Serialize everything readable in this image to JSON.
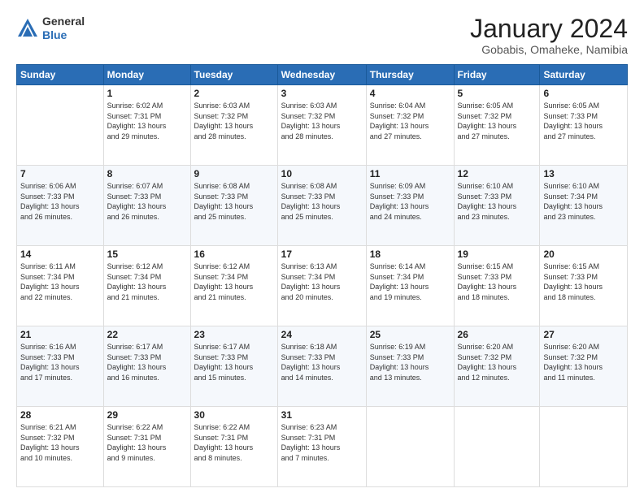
{
  "header": {
    "logo": {
      "line1": "General",
      "line2": "Blue"
    },
    "title": "January 2024",
    "location": "Gobabis, Omaheke, Namibia"
  },
  "days_of_week": [
    "Sunday",
    "Monday",
    "Tuesday",
    "Wednesday",
    "Thursday",
    "Friday",
    "Saturday"
  ],
  "weeks": [
    [
      {
        "day": "",
        "info": ""
      },
      {
        "day": "1",
        "info": "Sunrise: 6:02 AM\nSunset: 7:31 PM\nDaylight: 13 hours\nand 29 minutes."
      },
      {
        "day": "2",
        "info": "Sunrise: 6:03 AM\nSunset: 7:32 PM\nDaylight: 13 hours\nand 28 minutes."
      },
      {
        "day": "3",
        "info": "Sunrise: 6:03 AM\nSunset: 7:32 PM\nDaylight: 13 hours\nand 28 minutes."
      },
      {
        "day": "4",
        "info": "Sunrise: 6:04 AM\nSunset: 7:32 PM\nDaylight: 13 hours\nand 27 minutes."
      },
      {
        "day": "5",
        "info": "Sunrise: 6:05 AM\nSunset: 7:32 PM\nDaylight: 13 hours\nand 27 minutes."
      },
      {
        "day": "6",
        "info": "Sunrise: 6:05 AM\nSunset: 7:33 PM\nDaylight: 13 hours\nand 27 minutes."
      }
    ],
    [
      {
        "day": "7",
        "info": "Sunrise: 6:06 AM\nSunset: 7:33 PM\nDaylight: 13 hours\nand 26 minutes."
      },
      {
        "day": "8",
        "info": "Sunrise: 6:07 AM\nSunset: 7:33 PM\nDaylight: 13 hours\nand 26 minutes."
      },
      {
        "day": "9",
        "info": "Sunrise: 6:08 AM\nSunset: 7:33 PM\nDaylight: 13 hours\nand 25 minutes."
      },
      {
        "day": "10",
        "info": "Sunrise: 6:08 AM\nSunset: 7:33 PM\nDaylight: 13 hours\nand 25 minutes."
      },
      {
        "day": "11",
        "info": "Sunrise: 6:09 AM\nSunset: 7:33 PM\nDaylight: 13 hours\nand 24 minutes."
      },
      {
        "day": "12",
        "info": "Sunrise: 6:10 AM\nSunset: 7:33 PM\nDaylight: 13 hours\nand 23 minutes."
      },
      {
        "day": "13",
        "info": "Sunrise: 6:10 AM\nSunset: 7:34 PM\nDaylight: 13 hours\nand 23 minutes."
      }
    ],
    [
      {
        "day": "14",
        "info": "Sunrise: 6:11 AM\nSunset: 7:34 PM\nDaylight: 13 hours\nand 22 minutes."
      },
      {
        "day": "15",
        "info": "Sunrise: 6:12 AM\nSunset: 7:34 PM\nDaylight: 13 hours\nand 21 minutes."
      },
      {
        "day": "16",
        "info": "Sunrise: 6:12 AM\nSunset: 7:34 PM\nDaylight: 13 hours\nand 21 minutes."
      },
      {
        "day": "17",
        "info": "Sunrise: 6:13 AM\nSunset: 7:34 PM\nDaylight: 13 hours\nand 20 minutes."
      },
      {
        "day": "18",
        "info": "Sunrise: 6:14 AM\nSunset: 7:34 PM\nDaylight: 13 hours\nand 19 minutes."
      },
      {
        "day": "19",
        "info": "Sunrise: 6:15 AM\nSunset: 7:33 PM\nDaylight: 13 hours\nand 18 minutes."
      },
      {
        "day": "20",
        "info": "Sunrise: 6:15 AM\nSunset: 7:33 PM\nDaylight: 13 hours\nand 18 minutes."
      }
    ],
    [
      {
        "day": "21",
        "info": "Sunrise: 6:16 AM\nSunset: 7:33 PM\nDaylight: 13 hours\nand 17 minutes."
      },
      {
        "day": "22",
        "info": "Sunrise: 6:17 AM\nSunset: 7:33 PM\nDaylight: 13 hours\nand 16 minutes."
      },
      {
        "day": "23",
        "info": "Sunrise: 6:17 AM\nSunset: 7:33 PM\nDaylight: 13 hours\nand 15 minutes."
      },
      {
        "day": "24",
        "info": "Sunrise: 6:18 AM\nSunset: 7:33 PM\nDaylight: 13 hours\nand 14 minutes."
      },
      {
        "day": "25",
        "info": "Sunrise: 6:19 AM\nSunset: 7:33 PM\nDaylight: 13 hours\nand 13 minutes."
      },
      {
        "day": "26",
        "info": "Sunrise: 6:20 AM\nSunset: 7:32 PM\nDaylight: 13 hours\nand 12 minutes."
      },
      {
        "day": "27",
        "info": "Sunrise: 6:20 AM\nSunset: 7:32 PM\nDaylight: 13 hours\nand 11 minutes."
      }
    ],
    [
      {
        "day": "28",
        "info": "Sunrise: 6:21 AM\nSunset: 7:32 PM\nDaylight: 13 hours\nand 10 minutes."
      },
      {
        "day": "29",
        "info": "Sunrise: 6:22 AM\nSunset: 7:31 PM\nDaylight: 13 hours\nand 9 minutes."
      },
      {
        "day": "30",
        "info": "Sunrise: 6:22 AM\nSunset: 7:31 PM\nDaylight: 13 hours\nand 8 minutes."
      },
      {
        "day": "31",
        "info": "Sunrise: 6:23 AM\nSunset: 7:31 PM\nDaylight: 13 hours\nand 7 minutes."
      },
      {
        "day": "",
        "info": ""
      },
      {
        "day": "",
        "info": ""
      },
      {
        "day": "",
        "info": ""
      }
    ]
  ]
}
